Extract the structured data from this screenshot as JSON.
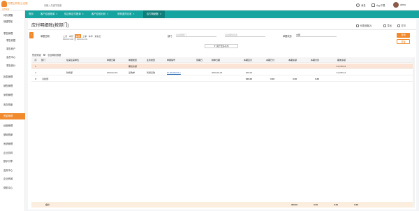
{
  "header": {
    "logo_text": "柠檬云财务云记账",
    "logo_sub": "发票管理",
    "search_placeholder": "请输入关键字搜索",
    "tools": [
      "消息",
      "App下载"
    ],
    "user": "demo"
  },
  "sidebar": {
    "items": [
      {
        "label": "待办提醒"
      },
      {
        "label": "快捷导航"
      },
      {
        "label": "零售管理"
      },
      {
        "label": "零售收银",
        "child": true
      },
      {
        "label": "零售商户",
        "child": true
      },
      {
        "label": "会员中心",
        "child": true
      },
      {
        "label": "零售统计",
        "child": true
      },
      {
        "label": "批发管理"
      },
      {
        "label": "销售管理"
      },
      {
        "label": "采购管理"
      },
      {
        "label": "库存档案"
      },
      {
        "label": "资金管理",
        "active": true
      },
      {
        "label": "经营管理"
      },
      {
        "label": "基础档案"
      },
      {
        "label": "系统管理"
      },
      {
        "label": "企业协同"
      },
      {
        "label": "数字引擎"
      },
      {
        "label": "应用中心"
      },
      {
        "label": "企业商城"
      },
      {
        "label": "帮助中心"
      }
    ]
  },
  "tabs": [
    {
      "label": "首页"
    },
    {
      "label": "客户应收账单",
      "close": true
    },
    {
      "label": "供应商应付账单",
      "close": true
    },
    {
      "label": "客户应收分析",
      "close": true
    },
    {
      "label": "采购退货应收",
      "close": true
    },
    {
      "label": "应付明细账",
      "close": true,
      "active": true
    }
  ],
  "page": {
    "title": "应付明细账(按部门)",
    "right_tools": [
      "分类设置(2)",
      "导出",
      "打印"
    ]
  },
  "filters": {
    "period_label": "单据日期",
    "period_options": [
      "上月",
      "本月",
      "本季",
      "上季",
      "本年",
      "其他日"
    ],
    "period_active": "本季",
    "date_range": "2023-01-01 至 2023-12-31",
    "dept_label": "部门",
    "dept_placeholder": "请选择部门",
    "supplier_placeholder": "请选择供应商",
    "status_label": "单据状态",
    "status_value": "全部",
    "query_button": "查询",
    "reset_button": "重置",
    "expand_button": "▼ 展开更多条件",
    "opt_label": "快速筛选",
    "opt_radio": "包含期初数据"
  },
  "table": {
    "headers": [
      "序",
      "部门",
      "往来往来单位",
      "单据日期",
      "单据类型",
      "业务类型",
      "单据编号",
      "到期日",
      "制单日期",
      "本期应付",
      "本期已付",
      "本期余额",
      "本期付款",
      "期末余额"
    ],
    "rows": [
      {
        "cells": [
          "1",
          "",
          "",
          "",
          "期初余额",
          "",
          "",
          "",
          "",
          "",
          "",
          "",
          "",
          "41,725.44"
        ],
        "highlight": true
      },
      {
        "cells": [
          "2",
          "",
          "财务部",
          "2023-02-16",
          "采购单",
          "普通采购",
          "PI-20230216-1",
          "",
          "2023-02-16",
          "400.00",
          "",
          "",
          "",
          "41,325.44"
        ],
        "link_col": 6
      },
      {
        "cells": [
          "3",
          "【小计】",
          "",
          "",
          "",
          "",
          "",
          "",
          "",
          "400.00",
          "0.00",
          "0.00",
          "0.00",
          ""
        ],
        "total": true
      }
    ],
    "footer": [
      "合计",
      "400.00",
      "0.00",
      "0.00",
      "0.00"
    ]
  }
}
